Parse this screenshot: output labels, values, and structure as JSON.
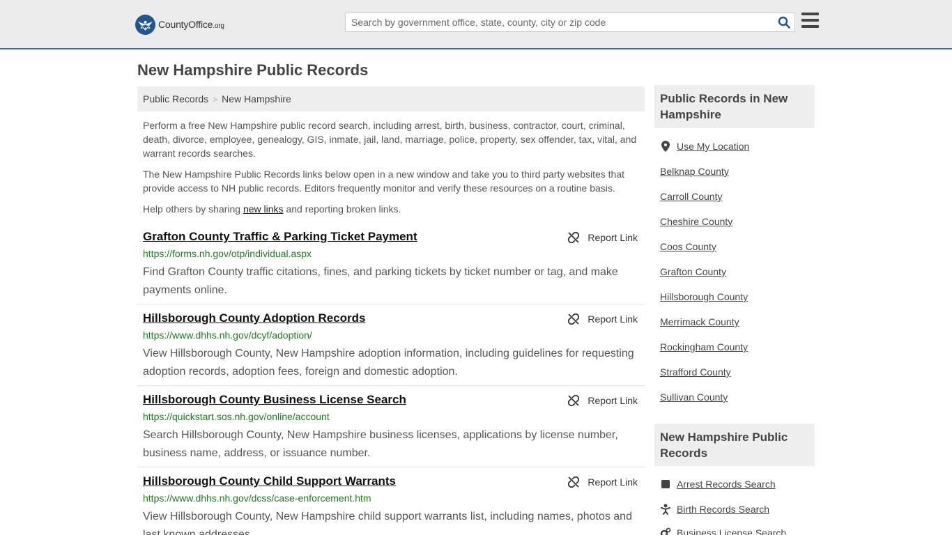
{
  "header": {
    "logo_text_main": "CountyOffice",
    "logo_text_tld": ".org",
    "search_placeholder": "Search by government office, state, county, city or zip code",
    "accent_color": "#3a6da3"
  },
  "page": {
    "title": "New Hampshire Public Records"
  },
  "breadcrumb": {
    "items": [
      "Public Records",
      "New Hampshire"
    ],
    "separator": ">"
  },
  "intro": {
    "paragraph1": "Perform a free New Hampshire public record search, including arrest, birth, business, contractor, court, criminal, death, divorce, employee, genealogy, GIS, inmate, jail, land, marriage, police, property, sex offender, tax, vital, and warrant records searches.",
    "paragraph2": "The New Hampshire Public Records links below open in a new window and take you to third party websites that provide access to NH public records. Editors frequently monitor and verify these resources on a routine basis.",
    "paragraph3_before": "Help others by sharing ",
    "paragraph3_link": "new links",
    "paragraph3_after": " and reporting broken links."
  },
  "results": [
    {
      "title": "Grafton County Traffic & Parking Ticket Payment",
      "url": "https://forms.nh.gov/otp/individual.aspx",
      "description": "Find Grafton County traffic citations, fines, and parking tickets by ticket number or tag, and make payments online.",
      "report_label": "Report Link"
    },
    {
      "title": "Hillsborough County Adoption Records",
      "url": "https://www.dhhs.nh.gov/dcyf/adoption/",
      "description": "View Hillsborough County, New Hampshire adoption information, including guidelines for requesting adoption records, adoption fees, foreign and domestic adoption.",
      "report_label": "Report Link"
    },
    {
      "title": "Hillsborough County Business License Search",
      "url": "https://quickstart.sos.nh.gov/online/account",
      "description": "Search Hillsborough County, New Hampshire business licenses, applications by license number, business name, address, or issuance number.",
      "report_label": "Report Link"
    },
    {
      "title": "Hillsborough County Child Support Warrants",
      "url": "https://www.dhhs.nh.gov/dcss/case-enforcement.htm",
      "description": "View Hillsborough County, New Hampshire child support warrants list, including names, photos and last known addresses.",
      "report_label": "Report Link"
    }
  ],
  "sidebar": {
    "box1_title": "Public Records in New Hampshire",
    "use_location": "Use My Location",
    "counties": [
      "Belknap County",
      "Carroll County",
      "Cheshire County",
      "Coos County",
      "Grafton County",
      "Hillsborough County",
      "Merrimack County",
      "Rockingham County",
      "Strafford County",
      "Sullivan County"
    ],
    "box2_title": "New Hampshire Public Records",
    "record_links": [
      {
        "label": "Arrest Records Search",
        "icon": "square-icon"
      },
      {
        "label": "Birth Records Search",
        "icon": "baby-icon"
      },
      {
        "label": "Business License Search",
        "icon": "gears-icon"
      }
    ]
  }
}
